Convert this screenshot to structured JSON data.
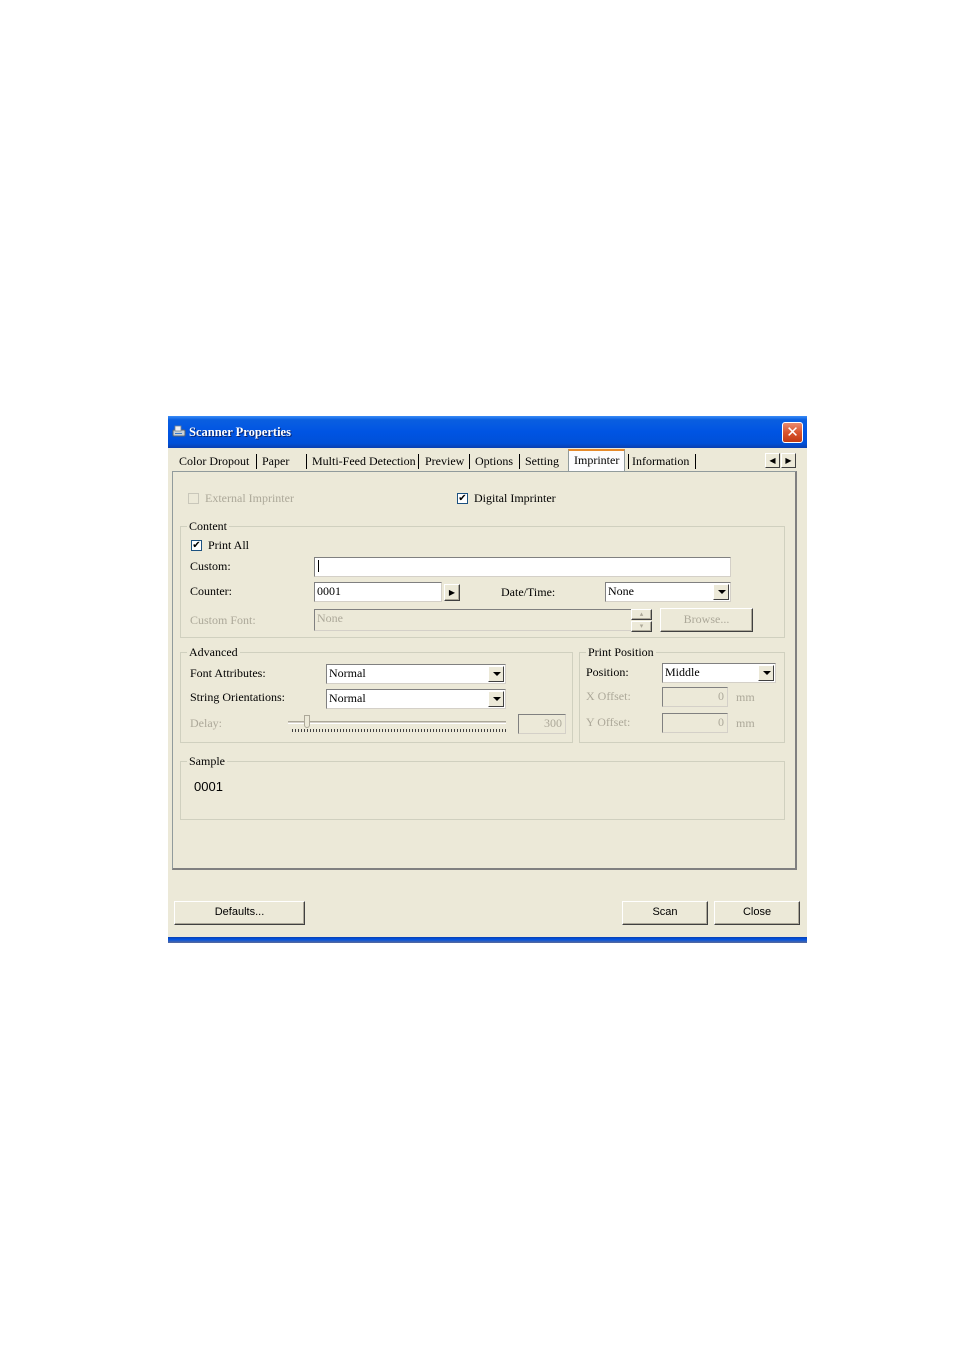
{
  "window": {
    "title": "Scanner Properties",
    "icon": "scanner-icon",
    "close_glyph": "✕"
  },
  "tabs": [
    {
      "label": "Color Dropout",
      "active": false
    },
    {
      "label": "Paper",
      "active": false
    },
    {
      "label": "Multi-Feed Detection",
      "active": false
    },
    {
      "label": "Preview",
      "active": false
    },
    {
      "label": "Options",
      "active": false
    },
    {
      "label": "Setting",
      "active": false
    },
    {
      "label": "Imprinter",
      "active": true
    },
    {
      "label": "Information",
      "active": false
    }
  ],
  "tab_scroll": {
    "left": "◀",
    "right": "▶"
  },
  "imprinter": {
    "external_imprinter": {
      "label": "External Imprinter",
      "checked": false,
      "enabled": false
    },
    "digital_imprinter": {
      "label": "Digital Imprinter",
      "checked": true,
      "enabled": true
    },
    "check_glyph": "✔"
  },
  "content": {
    "title": "Content",
    "print_all": {
      "label": "Print All",
      "checked": true
    },
    "custom": {
      "label": "Custom:",
      "value": ""
    },
    "counter": {
      "label": "Counter:",
      "value": "0001",
      "button_glyph": "▶"
    },
    "date_time": {
      "label": "Date/Time:",
      "value": "None"
    },
    "custom_font": {
      "label": "Custom Font:",
      "value": "None",
      "enabled": false
    },
    "spin_up": "▴",
    "spin_down": "▾",
    "browse_label": "Browse..."
  },
  "advanced": {
    "title": "Advanced",
    "font_attributes": {
      "label": "Font Attributes:",
      "value": "Normal"
    },
    "string_orientations": {
      "label": "String Orientations:",
      "value": "Normal"
    },
    "delay": {
      "label": "Delay:",
      "value": "300",
      "enabled": false,
      "slider_fraction": 0.04
    }
  },
  "print_position": {
    "title": "Print Position",
    "position": {
      "label": "Position:",
      "value": "Middle"
    },
    "x_offset": {
      "label": "X Offset:",
      "value": "0",
      "unit": "mm",
      "enabled": false
    },
    "y_offset": {
      "label": "Y Offset:",
      "value": "0",
      "unit": "mm",
      "enabled": false
    }
  },
  "sample": {
    "title": "Sample",
    "value": "0001"
  },
  "footer": {
    "defaults_label": "Defaults...",
    "scan_label": "Scan",
    "close_label": "Close"
  }
}
